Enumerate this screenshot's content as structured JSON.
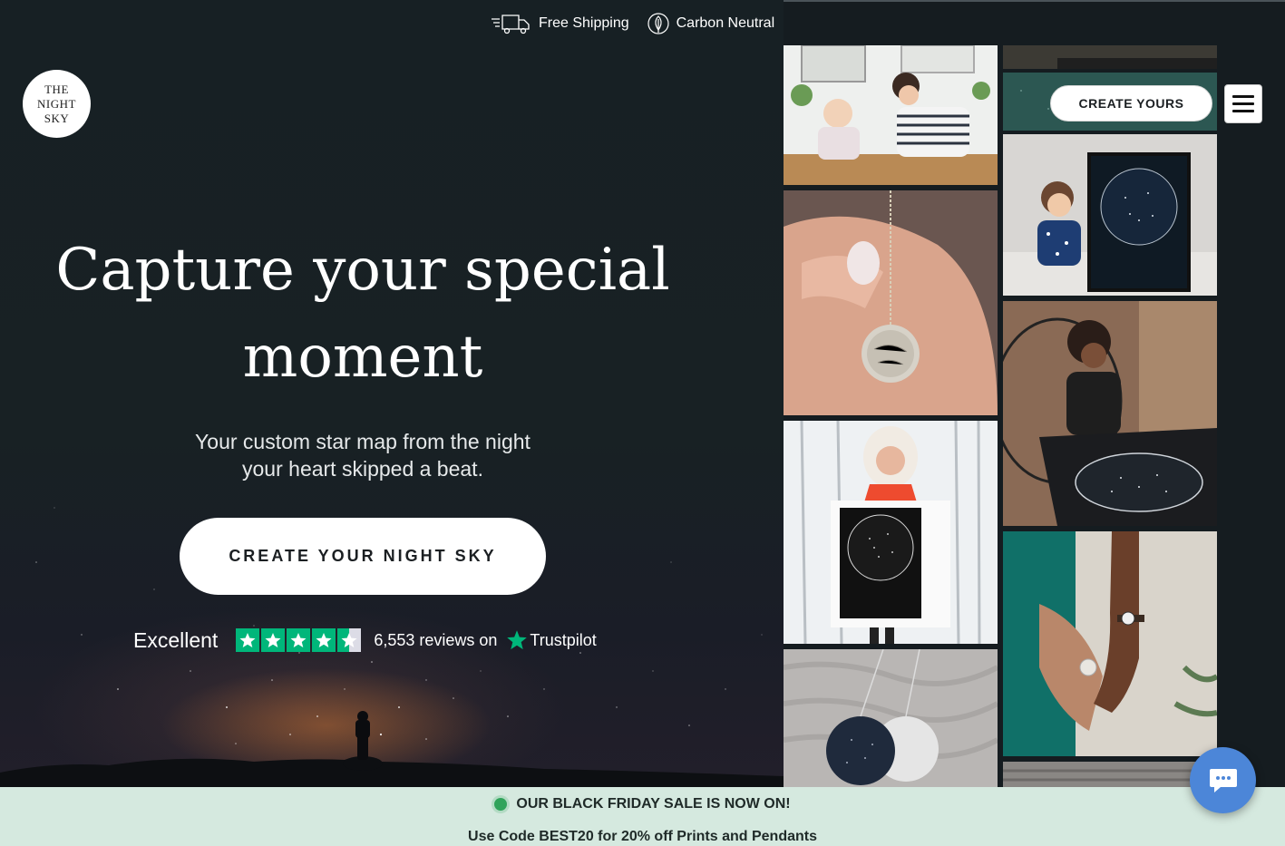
{
  "utility_bar": {
    "shipping_label": "Free Shipping",
    "shipping_icon": "delivery-truck-icon",
    "carbon_label": "Carbon Neutral",
    "carbon_icon": "leaf-icon"
  },
  "logo": {
    "line1": "THE",
    "line2": "NIGHT",
    "line3": "SKY"
  },
  "hero": {
    "headline_line1": "Capture your special",
    "headline_line2": "moment",
    "subhead_line1": "Your custom star map from the night",
    "subhead_line2": "your heart skipped a beat.",
    "cta_label": "CREATE YOUR NIGHT SKY"
  },
  "trustpilot": {
    "rating_label": "Excellent",
    "stars": 4.5,
    "reviews_text": "6,553 reviews on",
    "brand": "Trustpilot",
    "color": "#00b67a"
  },
  "header": {
    "create_label": "CREATE YOURS",
    "menu_icon": "hamburger-menu-icon"
  },
  "chat": {
    "icon": "chat-bubble-icon",
    "color": "#4c86d8"
  },
  "banner": {
    "line1": "OUR BLACK FRIDAY SALE IS NOW ON!",
    "line2": "Use Code BEST20 for 20% off Prints and Pendants",
    "background": "#d5e9df",
    "dot_color": "#2fa35a"
  },
  "colors": {
    "page_bg": "#151c20"
  }
}
